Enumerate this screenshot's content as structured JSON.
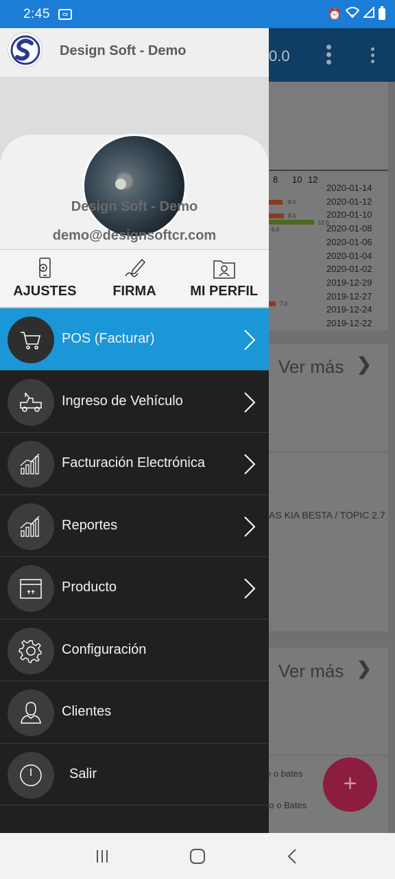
{
  "status_bar": {
    "time": "2:45"
  },
  "background": {
    "appbar_value": "0.0",
    "chart_ticks": [
      "8",
      "10",
      "12"
    ],
    "chart_dates": [
      "2020-01-14",
      "2020-01-12",
      "2020-01-10",
      "2020-01-08",
      "2020-01-06",
      "2020-01-04",
      "2020-01-02",
      "2019-12-29",
      "2019-12-27",
      "2019-12-24",
      "2019-12-22"
    ],
    "bar_labels": [
      "8.0",
      "8.0",
      "12.0",
      "6.0",
      "7.0"
    ],
    "ver_mas_1": "Ver más",
    "vehicle_text": "AS KIA BESTA / TOPIC 2.7",
    "ver_mas_2": "Ver más",
    "bottom_text_1": "o o bates",
    "bottom_text_2": "ro o Bates",
    "fab_label": "+"
  },
  "drawer": {
    "header_title": "Design Soft - Demo",
    "profile_name": "Design Soft - Demo",
    "profile_email": "demo@designsoftcr.com",
    "actions": [
      {
        "label": "AJUSTES",
        "icon": "phone-settings-icon"
      },
      {
        "label": "FIRMA",
        "icon": "signature-pen-icon"
      },
      {
        "label": "MI PERFIL",
        "icon": "profile-folder-icon"
      }
    ],
    "menu": [
      {
        "label": "POS (Facturar)",
        "icon": "cart-icon",
        "active": true,
        "chevron": true
      },
      {
        "label": "Ingreso de Vehículo",
        "icon": "tow-truck-icon",
        "active": false,
        "chevron": true
      },
      {
        "label": "Facturación Electrónica",
        "icon": "bar-chart-icon",
        "active": false,
        "chevron": true
      },
      {
        "label": "Reportes",
        "icon": "bar-chart-icon",
        "active": false,
        "chevron": true
      },
      {
        "label": "Producto",
        "icon": "box-icon",
        "active": false,
        "chevron": true
      },
      {
        "label": "Configuración",
        "icon": "gear-icon",
        "active": false,
        "chevron": false
      },
      {
        "label": "Clientes",
        "icon": "user-icon",
        "active": false,
        "chevron": false
      },
      {
        "label": "Salir",
        "icon": "power-icon",
        "active": false,
        "chevron": false
      }
    ]
  },
  "colors": {
    "status_bar": "#1b7dd6",
    "active_item": "#1b96d6",
    "drawer_bg": "#202020",
    "fab": "#8c1d3f"
  }
}
